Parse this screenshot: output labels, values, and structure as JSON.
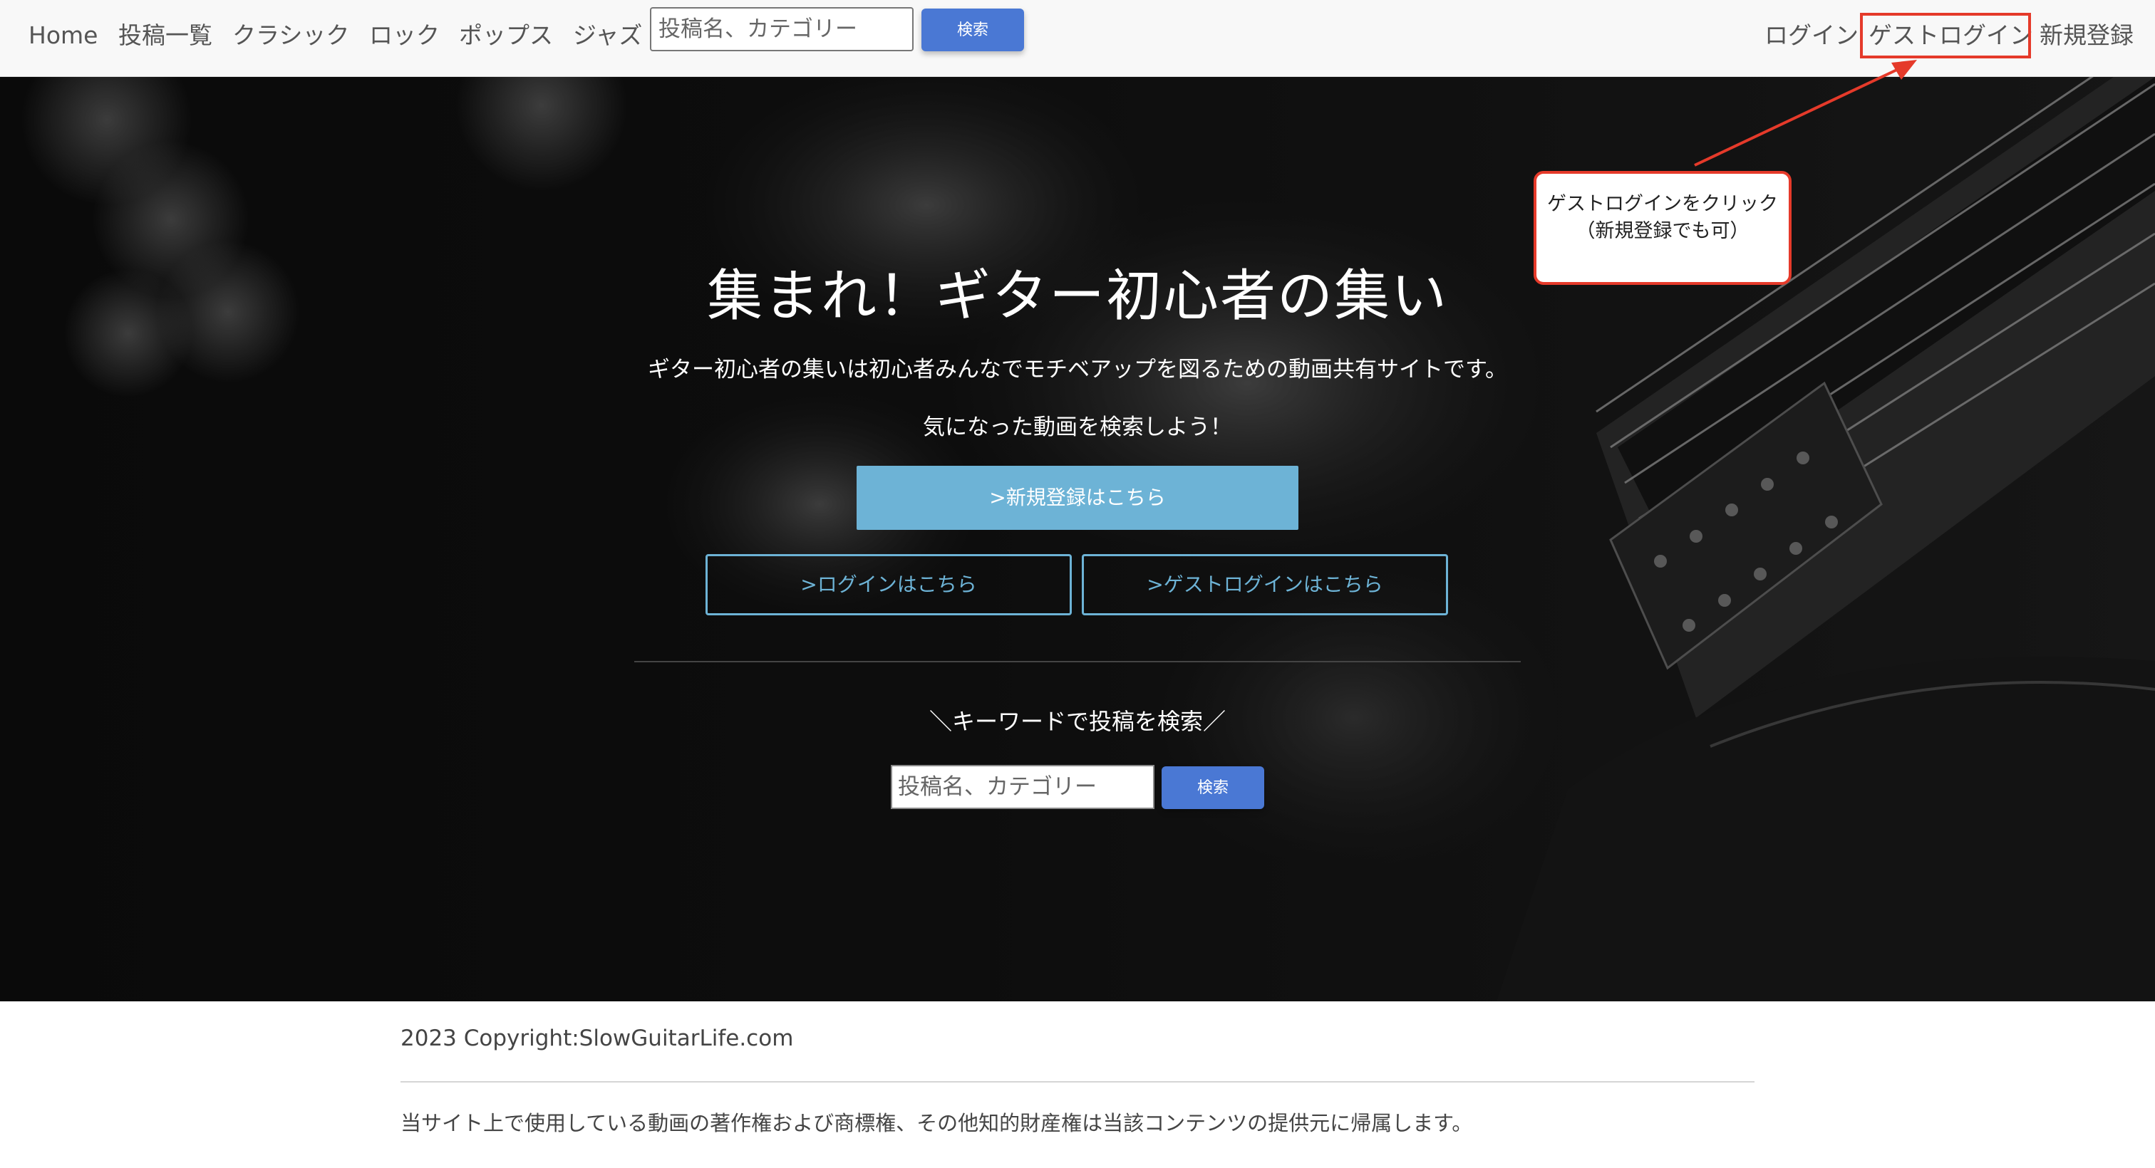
{
  "nav": {
    "home": "Home",
    "posts": "投稿一覧",
    "classic": "クラシック",
    "rock": "ロック",
    "pops": "ポップス",
    "jazz": "ジャズ",
    "search_placeholder": "投稿名、カテゴリー",
    "search_button": "検索",
    "login": "ログイン",
    "guest_login": "ゲストログイン",
    "signup": "新規登録"
  },
  "hero": {
    "title": "集まれ！ギター初心者の集い",
    "description": "ギター初心者の集いは初心者みんなでモチベアップを図るための動画共有サイトです。",
    "prompt": "気になった動画を検索しよう！",
    "signup_button": ">新規登録はこちら",
    "login_button": ">ログインはこちら",
    "guest_login_button": ">ゲストログインはこちら",
    "search_heading": "＼キーワードで投稿を検索／",
    "search_placeholder": "投稿名、カテゴリー",
    "search_button": "検索"
  },
  "annotation": {
    "line1": "ゲストログインをクリック",
    "line2": "（新規登録でも可）"
  },
  "footer": {
    "copyright": "2023 Copyright:SlowGuitarLife.com",
    "notice": "当サイト上で使用している動画の著作権および商標権、その他知的財産権は当該コンテンツの提供元に帰属します。"
  },
  "colors": {
    "accent_blue": "#4a78d4",
    "hero_button": "#6db3d6",
    "annotation_red": "#e53a2a"
  }
}
